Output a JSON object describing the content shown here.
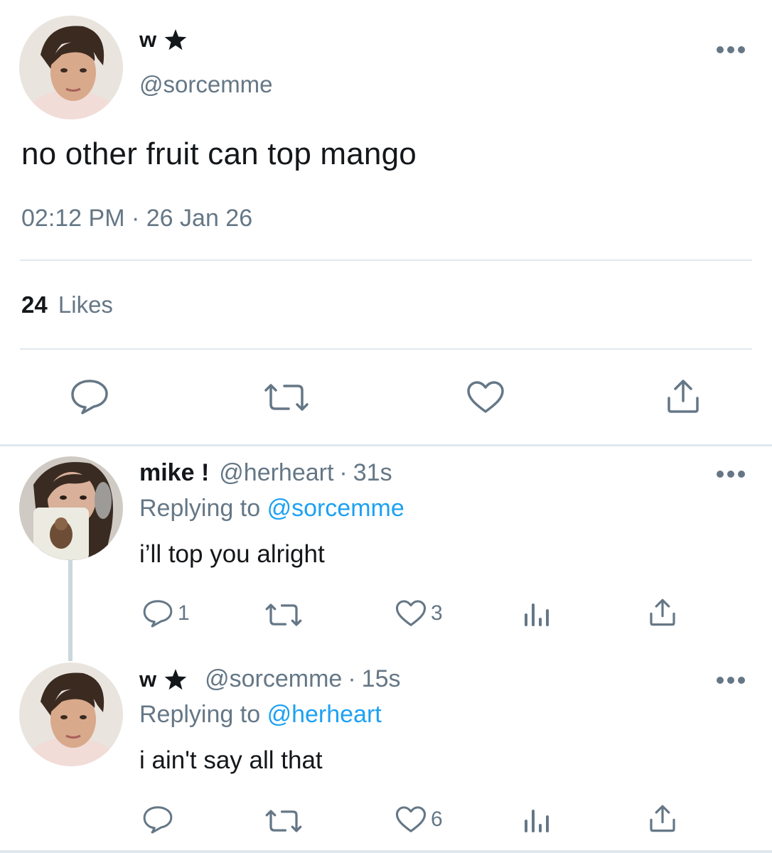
{
  "main_tweet": {
    "name": "w",
    "name_icon": "star-icon",
    "handle": "@sorcemme",
    "text": "no other fruit can top mango",
    "time": "02:12 PM",
    "separator": "·",
    "date": "26 Jan 26",
    "likes_count": "24",
    "likes_label": "Likes"
  },
  "replies": [
    {
      "name": "mike !",
      "handle": "@herheart",
      "separator": "·",
      "age": "31s",
      "replying_label": "Replying to",
      "replying_to": "@sorcemme",
      "text": "i’ll top you alright",
      "reply_count": "1",
      "retweet_count": "",
      "like_count": "3"
    },
    {
      "name": "w",
      "name_icon": "star-icon",
      "handle": "@sorcemme",
      "separator": "·",
      "age": "15s",
      "replying_label": "Replying to",
      "replying_to": "@herheart",
      "text": "i ain't say all that",
      "reply_count": "",
      "retweet_count": "",
      "like_count": "6"
    }
  ],
  "colors": {
    "text": "#14171a",
    "secondary": "#657786",
    "mention": "#1da1f2",
    "divider": "#e1e8ed"
  }
}
